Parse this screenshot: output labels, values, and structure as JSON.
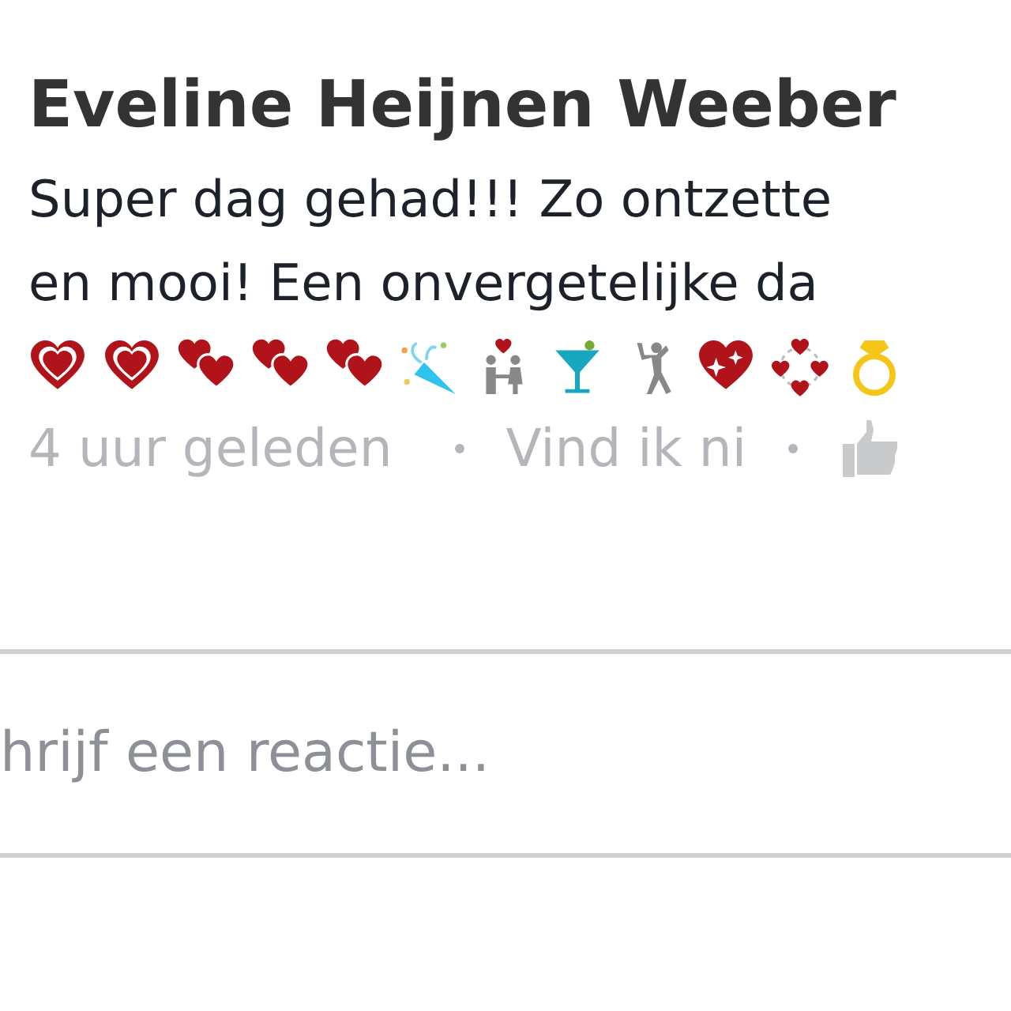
{
  "comment": {
    "author": "Eveline Heijnen Weeber",
    "lines": [
      "Super dag gehad!!! Zo ontzette",
      "en mooi! Een onvergetelijke da"
    ],
    "time": "4 uur geleden",
    "like_link": "Vind ik ni"
  },
  "reply_field": {
    "placeholder": "hrijf een reactie..."
  }
}
